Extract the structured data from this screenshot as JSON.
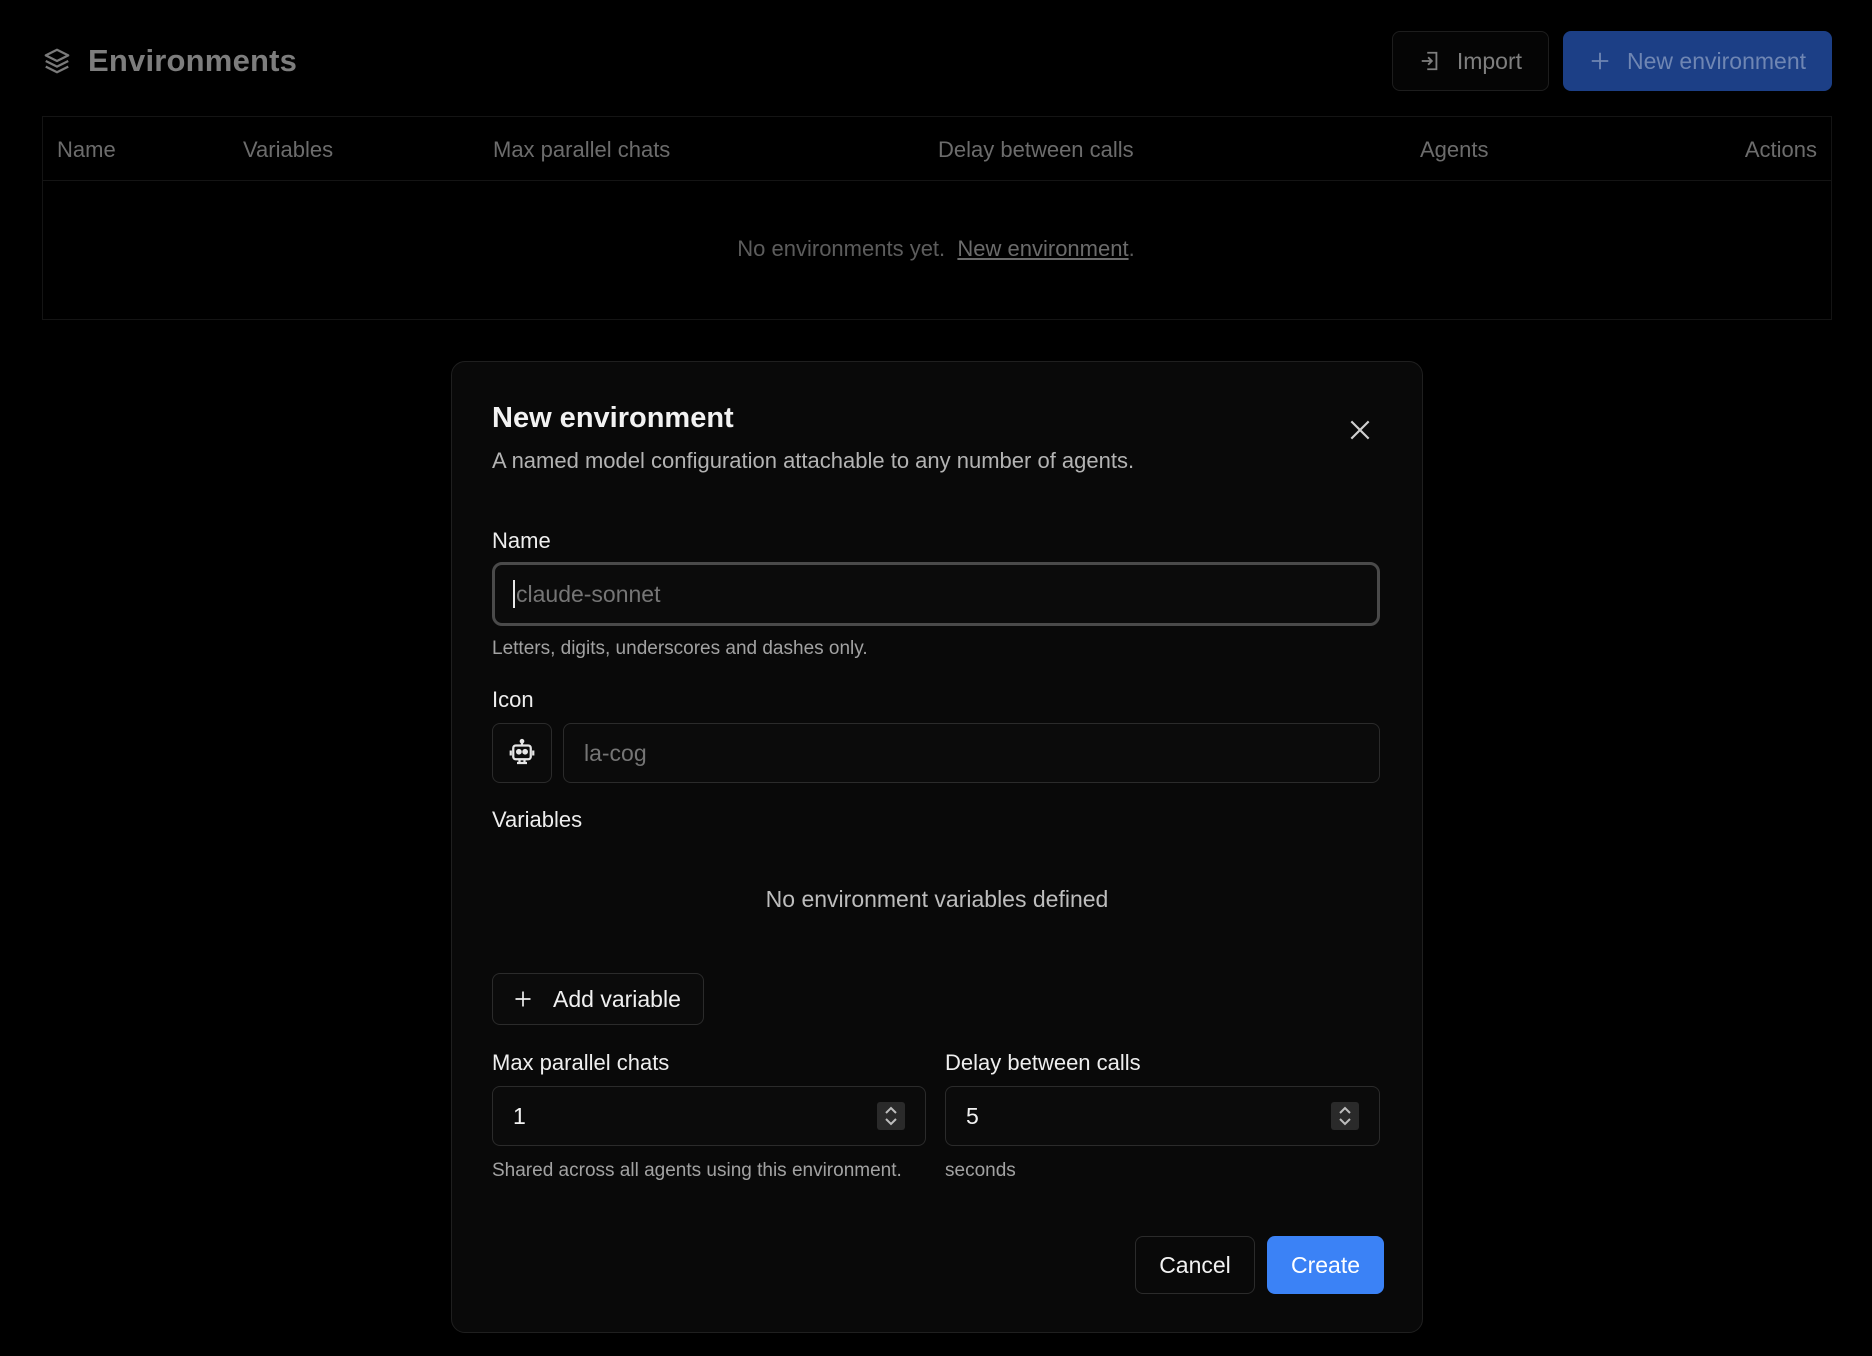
{
  "header": {
    "title": "Environments",
    "title_icon": "layers-icon",
    "import_label": "Import",
    "new_env_label": "New environment"
  },
  "table": {
    "columns": [
      "Name",
      "Variables",
      "Max parallel chats",
      "Delay between calls",
      "Agents",
      "Actions"
    ],
    "empty_text": "No environments yet.",
    "empty_link": "New environment",
    "empty_suffix": "."
  },
  "modal": {
    "title": "New environment",
    "subtitle": "A named model configuration attachable to any number of agents.",
    "name_label": "Name",
    "name_value": "",
    "name_placeholder": "claude-sonnet",
    "name_help": "Letters, digits, underscores and dashes only.",
    "icon_label": "Icon",
    "icon_preview": "robot-icon",
    "icon_value": "",
    "icon_placeholder": "la-cog",
    "variables_label": "Variables",
    "variables_empty": "No environment variables defined",
    "add_variable_label": "Add variable",
    "max_parallel_label": "Max parallel chats",
    "max_parallel_value": "1",
    "max_parallel_help": "Shared across all agents using this environment.",
    "delay_label": "Delay between calls",
    "delay_value": "5",
    "delay_help": "seconds",
    "cancel_label": "Cancel",
    "create_label": "Create"
  },
  "colors": {
    "background": "#000000",
    "modal_bg": "#090909",
    "primary": "#3b82f6",
    "primary_dimmed": "#1c3f86"
  }
}
